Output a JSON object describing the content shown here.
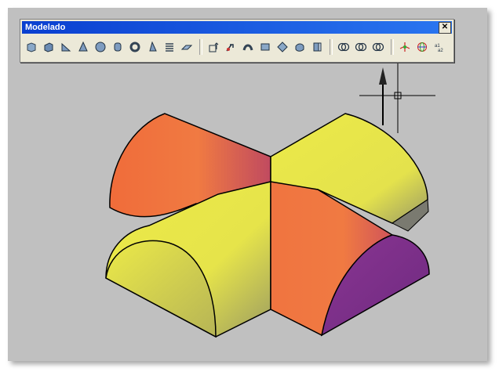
{
  "toolbar": {
    "title": "Modelado",
    "close_label": "✕",
    "groups": [
      [
        "polysolid-icon",
        "box-icon",
        "wedge-icon",
        "cone-icon",
        "sphere-icon",
        "cylinder-icon",
        "torus-icon",
        "pyramid-icon",
        "helix-icon",
        "planar-surface-icon"
      ],
      [
        "extrude-icon",
        "presspull-icon",
        "sweep-icon",
        "revolve-icon",
        "loft-icon",
        "union-solid-icon",
        "subtract-solid-icon"
      ],
      [
        "union-icon",
        "subtract-icon",
        "intersect-icon"
      ],
      [
        "3d-move-icon",
        "3d-rotate-icon",
        "3d-align-icon"
      ]
    ]
  },
  "viewport": {
    "background": "#c0c0c0",
    "colors": {
      "orange": "#f2793d",
      "yellow": "#ecea48",
      "purple": "#7a2e8a"
    }
  }
}
